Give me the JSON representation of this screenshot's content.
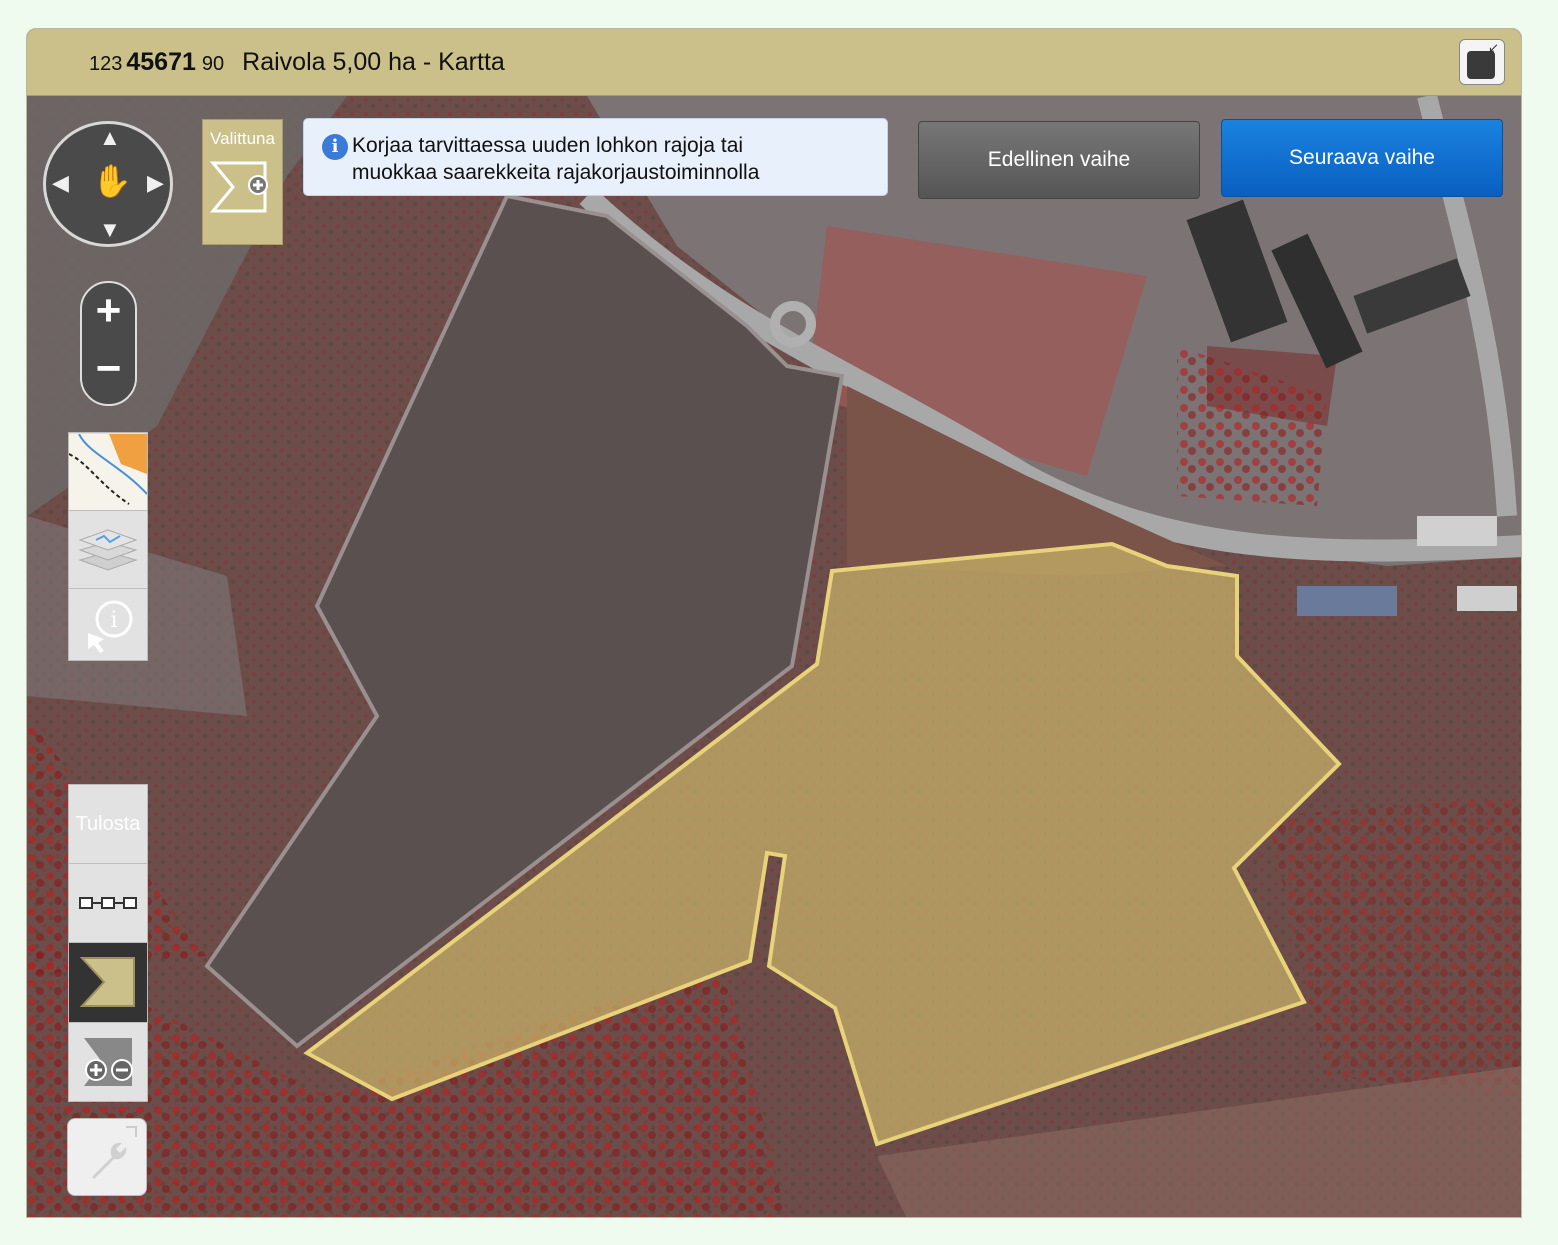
{
  "header": {
    "parcel_prefix": "123",
    "parcel_main": "45671",
    "parcel_suffix": "90",
    "title": "Raivola 5,00  ha - Kartta"
  },
  "controls": {
    "selected_label": "Valittuna",
    "print_label": "Tulosta"
  },
  "info": {
    "message_line1": "Korjaa tarvittaessa uuden lohkon rajoja tai",
    "message_line2": "muokkaa saarekkeita rajakorjaustoiminnolla"
  },
  "buttons": {
    "previous": "Edellinen vaihe",
    "next": "Seuraava vaihe"
  },
  "icons": [
    "expand-icon",
    "pan-hand-icon",
    "arrow-up-icon",
    "arrow-down-icon",
    "arrow-left-icon",
    "arrow-right-icon",
    "add-parcel-icon",
    "info-icon",
    "zoom-in-icon",
    "zoom-out-icon",
    "basemap-icon",
    "layers-icon",
    "identify-icon",
    "measure-icon",
    "parcel-draw-icon",
    "island-edit-icon",
    "wrench-icon"
  ],
  "colors": {
    "title_bar": "#cbbf8a",
    "selected_parcel": "#e8cf7a",
    "next_button": "#0a6fd8",
    "prev_button": "#666666"
  }
}
